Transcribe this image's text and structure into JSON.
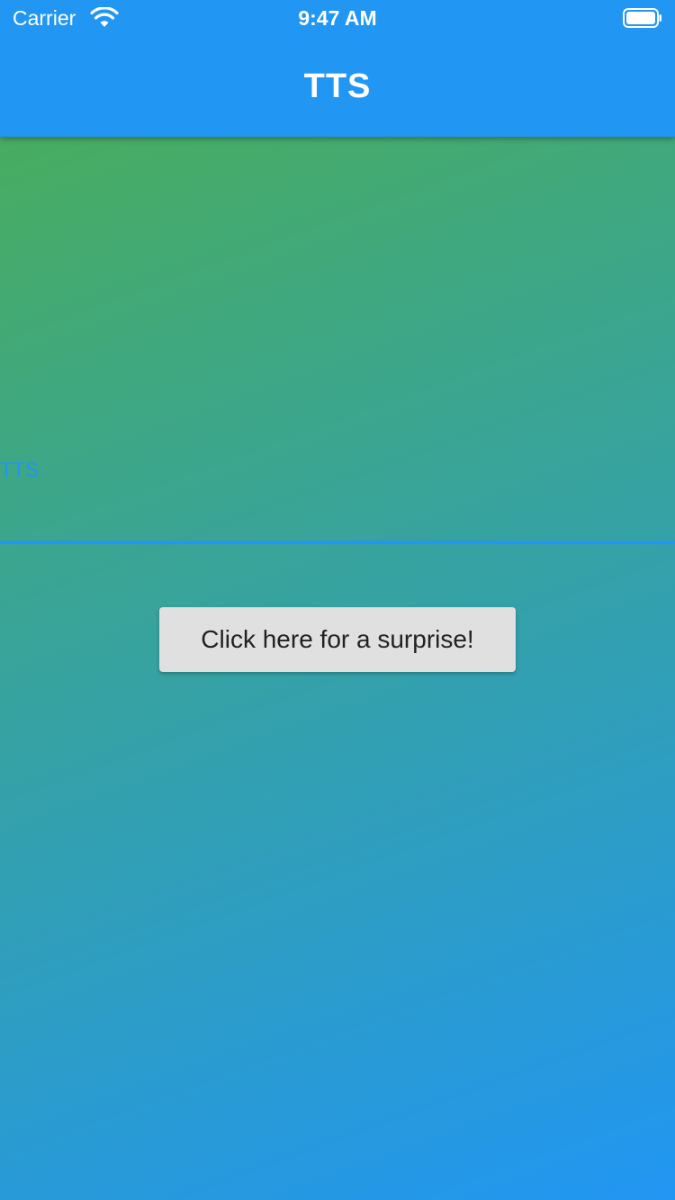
{
  "status_bar": {
    "carrier": "Carrier",
    "time": "9:47 AM",
    "wifi_icon": "wifi-icon",
    "battery_icon": "battery-full-icon"
  },
  "app_bar": {
    "title": "TTS",
    "color": "#2196F3"
  },
  "content": {
    "text_label": "TTS",
    "button_label": "Click here for a surprise!",
    "gradient_start": "#4CAF50",
    "gradient_end": "#2196F3",
    "divider_color": "#2196F3"
  }
}
